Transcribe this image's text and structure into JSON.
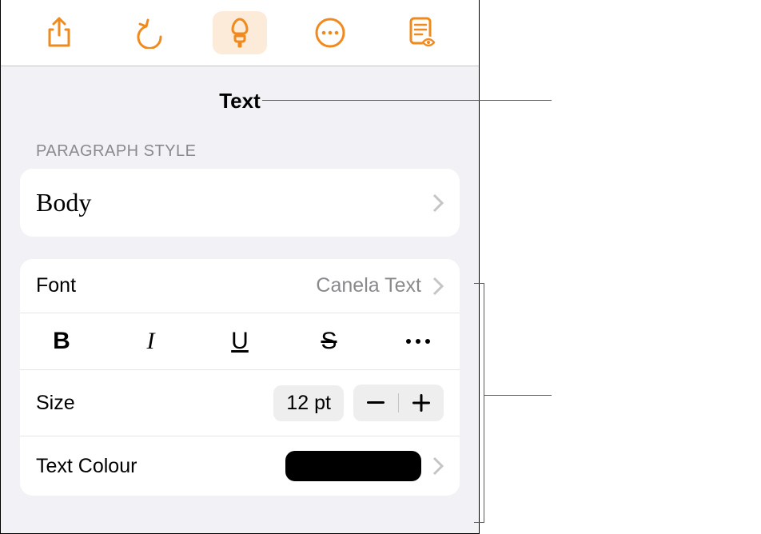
{
  "tab_title": "Text",
  "paragraph_section_label": "PARAGRAPH STYLE",
  "paragraph_style_name": "Body",
  "font": {
    "label": "Font",
    "value": "Canela Text"
  },
  "style_buttons": {
    "bold": "B",
    "italic": "I",
    "underline": "U",
    "strike": "S"
  },
  "size": {
    "label": "Size",
    "value": "12 pt"
  },
  "text_colour": {
    "label": "Text Colour",
    "color": "#000000"
  },
  "toolbar": {
    "active_index": 2
  }
}
